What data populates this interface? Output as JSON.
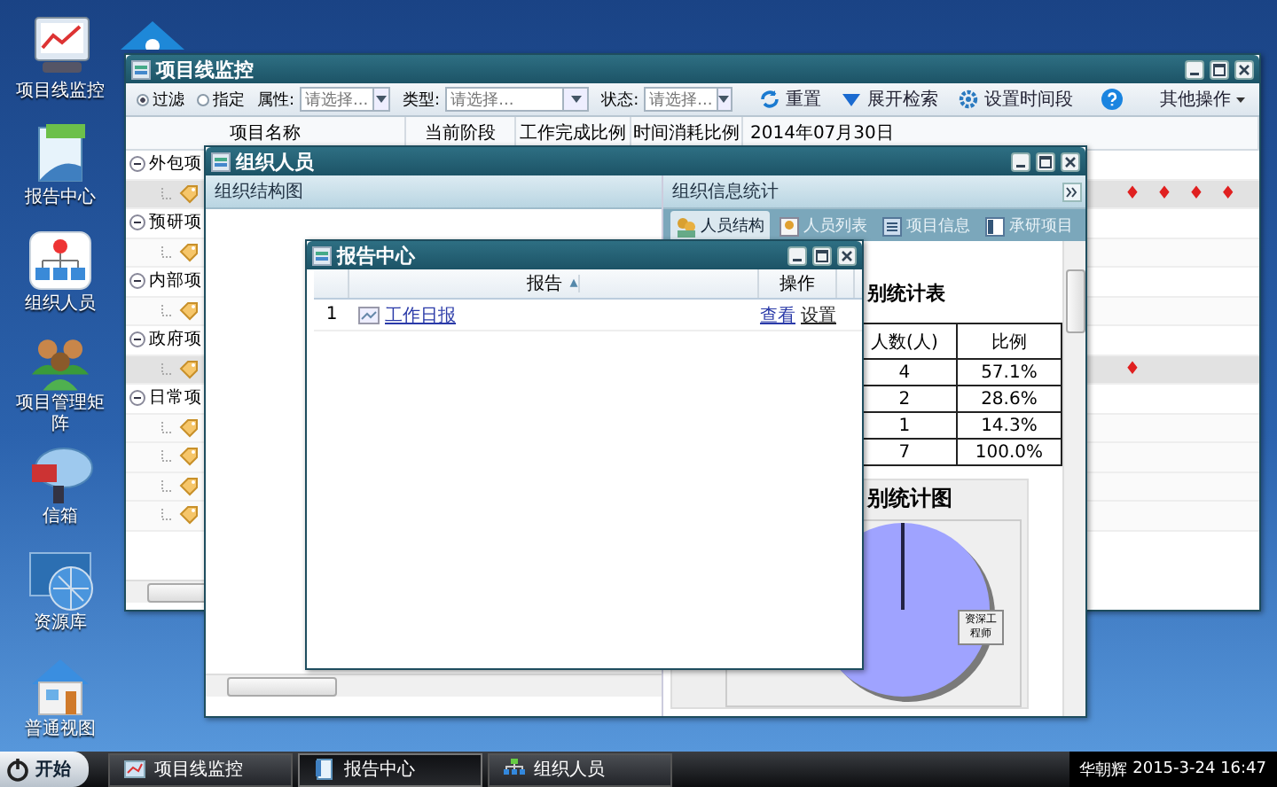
{
  "desktop_icons": [
    {
      "label": "项目线监控",
      "kind": "monitor"
    },
    {
      "label": "报告中心",
      "kind": "report"
    },
    {
      "label": "组织人员",
      "kind": "org"
    },
    {
      "label": "项目管理矩阵",
      "kind": "people"
    },
    {
      "label": "信箱",
      "kind": "mail"
    },
    {
      "label": "资源库",
      "kind": "globe"
    },
    {
      "label": "普通视图",
      "kind": "house"
    }
  ],
  "project_monitor": {
    "title": "项目线监控",
    "filter_modes": [
      {
        "label": "过滤",
        "selected": true
      },
      {
        "label": "指定",
        "selected": false
      }
    ],
    "filters": [
      {
        "label": "属性:",
        "placeholder": "请选择..."
      },
      {
        "label": "类型:",
        "placeholder": "请选择..."
      },
      {
        "label": "状态:",
        "placeholder": "请选择..."
      }
    ],
    "actions": [
      {
        "label": "重置",
        "kind": "refresh"
      },
      {
        "label": "展开检索",
        "kind": "expand"
      },
      {
        "label": "设置时间段",
        "kind": "gear"
      }
    ],
    "more_menu": "其他操作",
    "columns": [
      "项目名称",
      "当前阶段",
      "工作完成比例",
      "时间消耗比例",
      "2014年07月30日"
    ],
    "groups": [
      {
        "name": "外包项",
        "expanded": true,
        "children": [
          {
            "kind": "tag",
            "markers": [
              "♦",
              "♦",
              "♦",
              "♦"
            ]
          }
        ]
      },
      {
        "name": "预研项",
        "expanded": true,
        "children": [
          {
            "kind": "tag"
          }
        ]
      },
      {
        "name": "内部项",
        "expanded": true,
        "children": [
          {
            "kind": "tag"
          }
        ]
      },
      {
        "name": "政府项",
        "expanded": true,
        "children": [
          {
            "kind": "tag",
            "markers": [
              "♦"
            ]
          }
        ]
      },
      {
        "name": "日常项",
        "expanded": true,
        "children": [
          {
            "kind": "tag"
          },
          {
            "kind": "tag"
          },
          {
            "kind": "tag"
          },
          {
            "kind": "tag"
          }
        ]
      }
    ]
  },
  "org_people": {
    "title": "组织人员",
    "left_panel": "组织结构图",
    "right_panel": "组织信息统计",
    "tabs": [
      {
        "label": "人员结构",
        "selected": true
      },
      {
        "label": "人员列表",
        "selected": false
      },
      {
        "label": "项目信息",
        "selected": false
      },
      {
        "label": "承研项目",
        "selected": false
      }
    ],
    "table_title": "别统计表",
    "table_columns": [
      "人数(人)",
      "比例"
    ],
    "table_rows": [
      [
        "4",
        "57.1%"
      ],
      [
        "2",
        "28.6%"
      ],
      [
        "1",
        "14.3%"
      ],
      [
        "7",
        "100.0%"
      ]
    ],
    "chart_title": "别统计图",
    "pie_label": "资深工程师"
  },
  "report_center": {
    "title": "报告中心",
    "columns": [
      {
        "label": "报告",
        "sort": "▴"
      },
      {
        "label": "操作"
      }
    ],
    "rows": [
      {
        "index": "1",
        "name": "工作日报",
        "actions": [
          "查看",
          "设置"
        ]
      }
    ]
  },
  "taskbar": {
    "start": "开始",
    "tasks": [
      {
        "label": "项目线监控",
        "selected": false
      },
      {
        "label": "报告中心",
        "selected": true
      },
      {
        "label": "组织人员",
        "selected": false
      }
    ],
    "user": "华朝辉",
    "clock": "2015-3-24 16:47"
  }
}
